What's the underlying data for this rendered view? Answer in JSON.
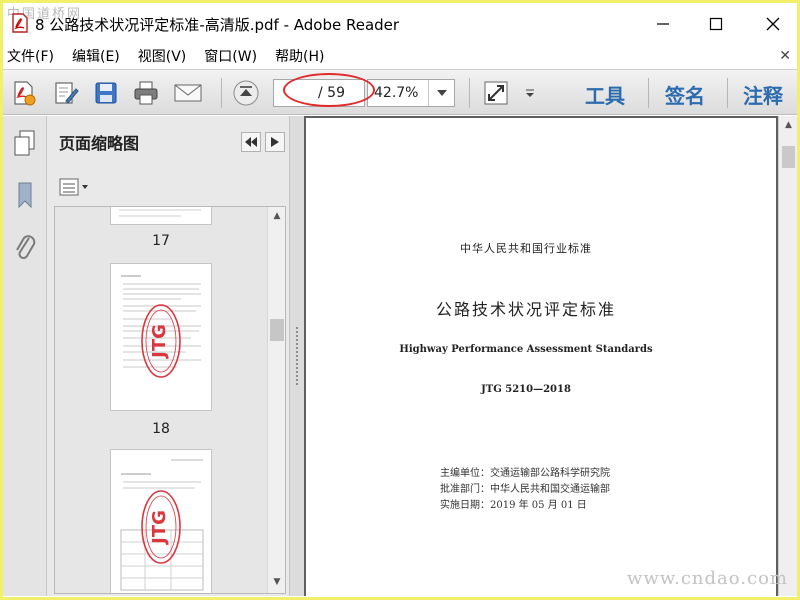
{
  "watermark_top": "中国道桥网",
  "watermark_bottom": "www.cndao.com",
  "window": {
    "title": "8 公路技术状况评定标准-高清版.pdf - Adobe Reader"
  },
  "menu": {
    "items": [
      {
        "label": "文件(F)"
      },
      {
        "label": "编辑(E)"
      },
      {
        "label": "视图(V)"
      },
      {
        "label": "窗口(W)"
      },
      {
        "label": "帮助(H)"
      }
    ]
  },
  "toolbar": {
    "page_current": "",
    "page_total": "/ 59",
    "zoom": "42.7%",
    "tools_label": "工具",
    "sign_label": "签名",
    "comment_label": "注释",
    "highlight_color": "#e02b2b"
  },
  "thumbnails": {
    "title": "页面缩略图",
    "pages": [
      {
        "label": "17"
      },
      {
        "label": "18"
      },
      {
        "label": ""
      }
    ],
    "stamp_text": "JTG",
    "stamp_color": "#d9363e"
  },
  "document": {
    "line1": "中华人民共和国行业标准",
    "title_cn": "公路技术状况评定标准",
    "title_en": "Highway Performance Assessment Standards",
    "code": "JTG 5210—2018",
    "meta": [
      "主编单位：交通运输部公路科学研究院",
      "批准部门：中华人民共和国交通运输部",
      "实施日期：2019 年 05 月 01 日"
    ]
  }
}
